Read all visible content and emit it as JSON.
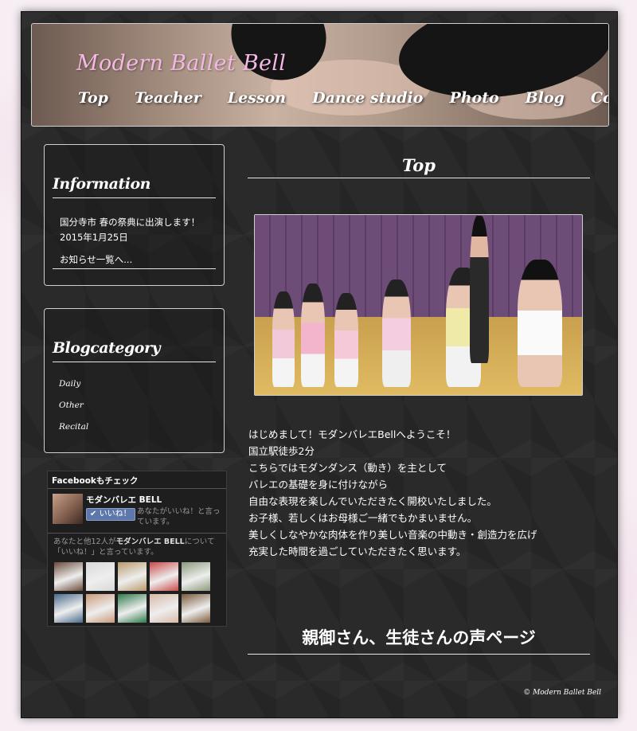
{
  "header": {
    "site_title": "Modern Ballet Bell",
    "nav": [
      "Top",
      "Teacher",
      "Lesson",
      "Dance studio",
      "Photo",
      "Blog",
      "Contact"
    ]
  },
  "sidebar": {
    "information": {
      "title": "Information",
      "item_text": "国分寺市 春の祭典に出演します！",
      "item_date": "2015年1月25日",
      "more_link": "お知らせ一覧へ..."
    },
    "blogcategory": {
      "title": "Blogcategory",
      "items": [
        "Daily",
        "Other",
        "Recital"
      ]
    },
    "facebook": {
      "heading": "Facebookもチェック",
      "page_name": "モダンバレエ BELL",
      "like_button": "いいね！",
      "like_note": "あなたがいいね！と言っています。",
      "friends_prefix": "あなたと他12人が",
      "friends_page": "モダンバレエ BELL",
      "friends_suffix": "について「いいね！」と言っています。",
      "friend_colors": [
        "#6a4a3a",
        "#d9d9d9",
        "#b89a6a",
        "#c94a4a",
        "#8a9a7a",
        "#4a6a8a",
        "#c99a7a",
        "#2e7a4a",
        "#d8b9a8",
        "#7a5a3a"
      ]
    }
  },
  "main": {
    "title": "Top",
    "intro_lines": [
      "はじめまして！モダンバレエBellへようこそ！",
      "国立駅徒歩2分",
      "こちらではモダンダンス（動き）を主として",
      "バレエの基礎を身に付けながら",
      "自由な表現を楽しんでいただきたく開校いたしました。",
      "お子様、若しくはお母様ご一緒でもかまいません。",
      "美しくしなやかな肉体を作り美しい音楽の中動き・創造力を広げ",
      "充実した時間を過ごしていただきたく思います。"
    ],
    "voices_link": "親御さん、生徒さんの声ページ"
  },
  "footer": {
    "copyright": "© Modern Ballet Bell"
  }
}
